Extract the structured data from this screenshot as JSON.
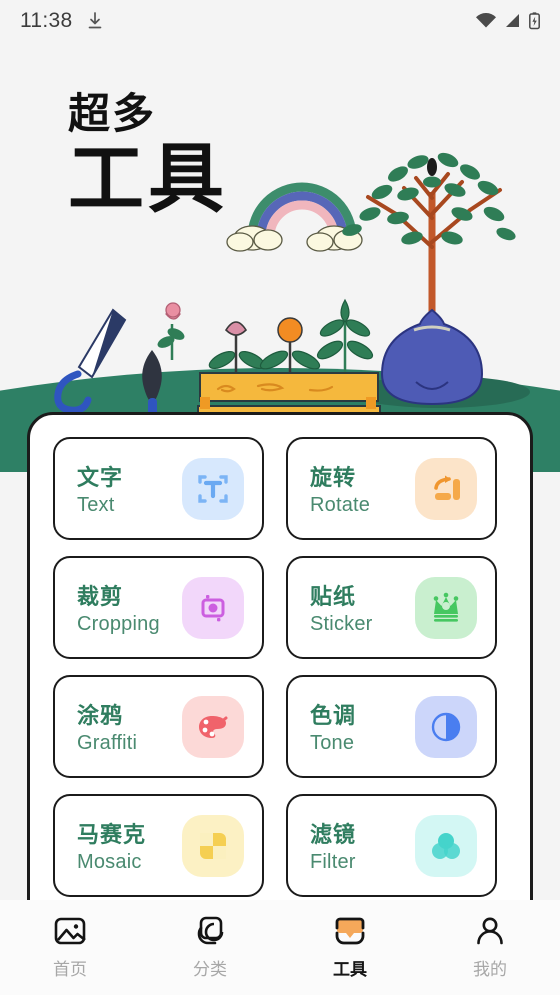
{
  "status_bar": {
    "time": "11:38",
    "icons": [
      "download-icon",
      "wifi-icon",
      "cellular-signal-icon",
      "battery-icon"
    ]
  },
  "hero": {
    "subtitle_cn": "超多",
    "title_cn": "工具",
    "illustration": "gardening-scene-with-tree-saw-trowel-planter-rainbow",
    "hill_color": "#2e8065"
  },
  "tools": [
    {
      "cn": "文字",
      "en": "Text",
      "icon": "text-tool-icon",
      "fg": "#7cb4f5",
      "bg": "#d7e8fd"
    },
    {
      "cn": "旋转",
      "en": "Rotate",
      "icon": "rotate-tool-icon",
      "fg": "#f5a councils",
      "bg": "#fce4c9"
    },
    {
      "cn": "裁剪",
      "en": "Cropping",
      "icon": "crop-tool-icon",
      "fg": "#cc5fe0",
      "bg": "#f2d7fa"
    },
    {
      "cn": "贴纸",
      "en": "Sticker",
      "icon": "crown-sticker-icon",
      "fg": "#46c761",
      "bg": "#c9efcf"
    },
    {
      "cn": "涂鸦",
      "en": "Graffiti",
      "icon": "palette-tool-icon",
      "fg": "#f0636b",
      "bg": "#fcd9d7"
    },
    {
      "cn": "色调",
      "en": "Tone",
      "icon": "contrast-tool-icon",
      "fg": "#4a7ef0",
      "bg": "#ccd6fa"
    },
    {
      "cn": "马赛克",
      "en": "Mosaic",
      "icon": "mosaic-tool-icon",
      "fg": "#f5cf52",
      "bg": "#fcf1c4"
    },
    {
      "cn": "滤镜",
      "en": "Filter",
      "icon": "filter-tool-icon",
      "fg": "#45d4cb",
      "bg": "#d3f7f4"
    }
  ],
  "bottom_nav": {
    "items": [
      {
        "label": "首页",
        "icon": "image-icon",
        "active": false
      },
      {
        "label": "分类",
        "icon": "layers-icon",
        "active": false
      },
      {
        "label": "工具",
        "icon": "toolbox-icon",
        "active": true
      },
      {
        "label": "我的",
        "icon": "person-icon",
        "active": false
      }
    ],
    "active_icon_color": "#f5a85a"
  }
}
